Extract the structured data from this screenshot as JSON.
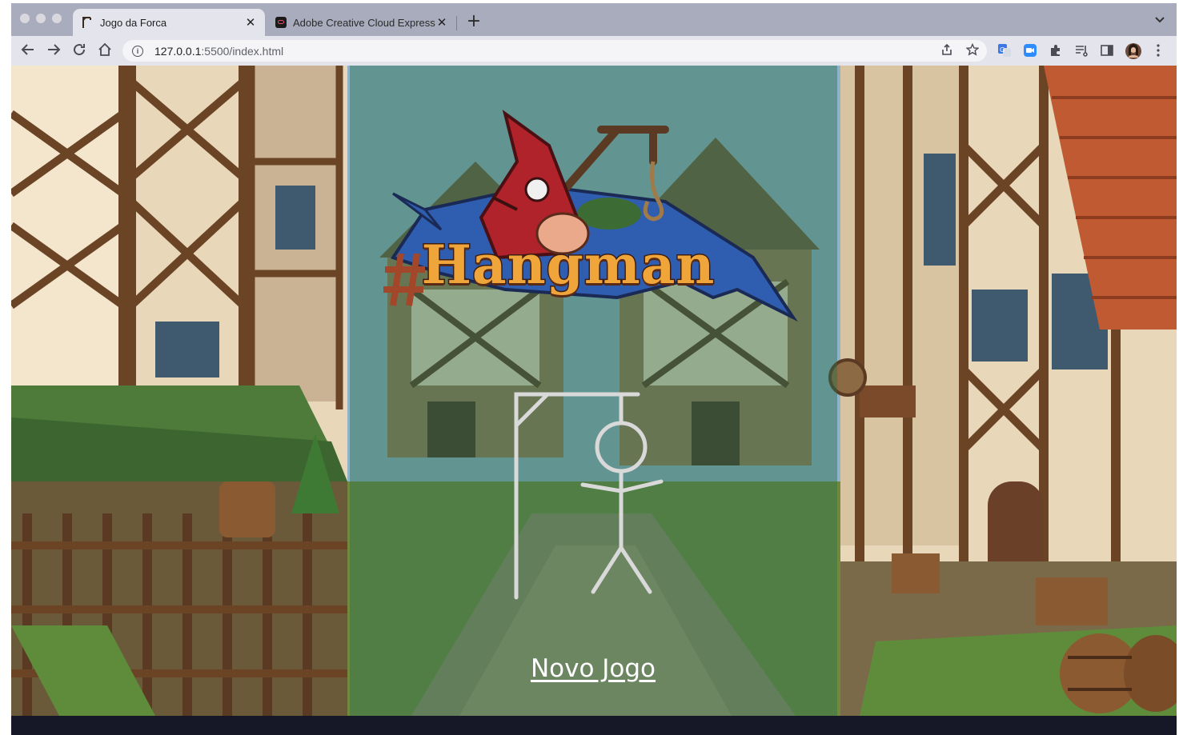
{
  "browser": {
    "tabs": [
      {
        "title": "Jogo da Forca",
        "active": true,
        "icon": "gallows-favicon-icon"
      },
      {
        "title": "Adobe Creative Cloud Express",
        "active": false,
        "icon": "creative-cloud-favicon-icon"
      }
    ],
    "new_tab_label": "+",
    "tab_close_label": "✕",
    "url_host": "127.0.0.1",
    "url_rest": ":5500/index.html"
  },
  "game": {
    "logo_text": "Hangman",
    "new_game_label": "Novo Jogo"
  },
  "colors": {
    "panel_overlay": "#2d6e4e",
    "logo_text": "#f0a53a",
    "banner_blue": "#2f5db0",
    "hood_red": "#b0232a",
    "figure_stroke": "#d9d9d9"
  }
}
